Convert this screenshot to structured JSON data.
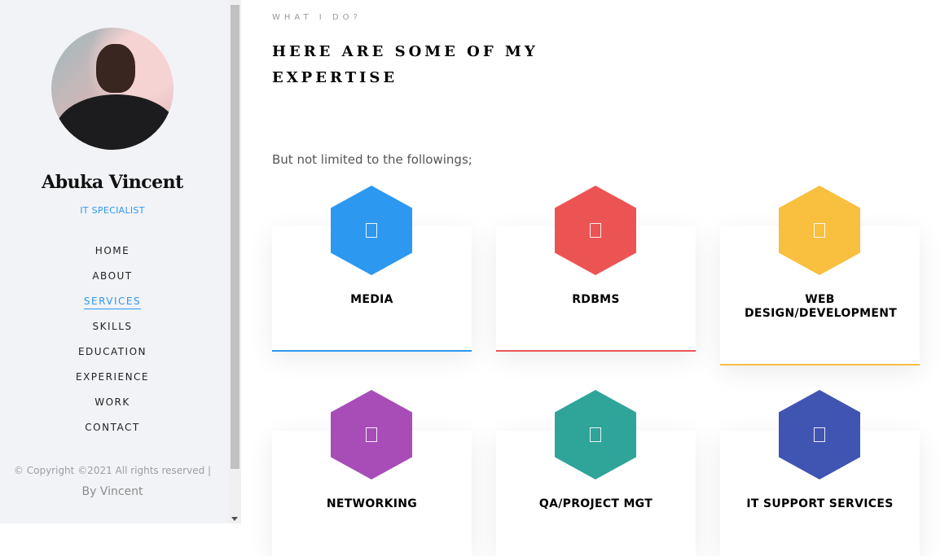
{
  "profile": {
    "name": "Abuka Vincent",
    "role": "IT SPECIALIST"
  },
  "nav": {
    "items": [
      {
        "label": "HOME"
      },
      {
        "label": "ABOUT"
      },
      {
        "label": "SERVICES",
        "active": true
      },
      {
        "label": "SKILLS"
      },
      {
        "label": "EDUCATION"
      },
      {
        "label": "EXPERIENCE"
      },
      {
        "label": "WORK"
      },
      {
        "label": "CONTACT"
      }
    ]
  },
  "footer": {
    "copyright": "© Copyright ©2021 All rights reserved |",
    "byline": "By Vincent"
  },
  "section": {
    "eyebrow": "WHAT I DO?",
    "heading": "HERE ARE SOME OF MY EXPERTISE",
    "intro": "But not limited to the followings;"
  },
  "services": [
    {
      "title": "MEDIA",
      "color": "#2c98f0"
    },
    {
      "title": "RDBMS",
      "color": "#ec5453"
    },
    {
      "title": "WEB DESIGN/DEVELOPMENT",
      "color": "#f9bf3f"
    },
    {
      "title": "NETWORKING",
      "color": "#a84cb8"
    },
    {
      "title": "QA/PROJECT MGT",
      "color": "#2fa499"
    },
    {
      "title": "IT SUPPORT SERVICES",
      "color": "#4054b2"
    }
  ]
}
